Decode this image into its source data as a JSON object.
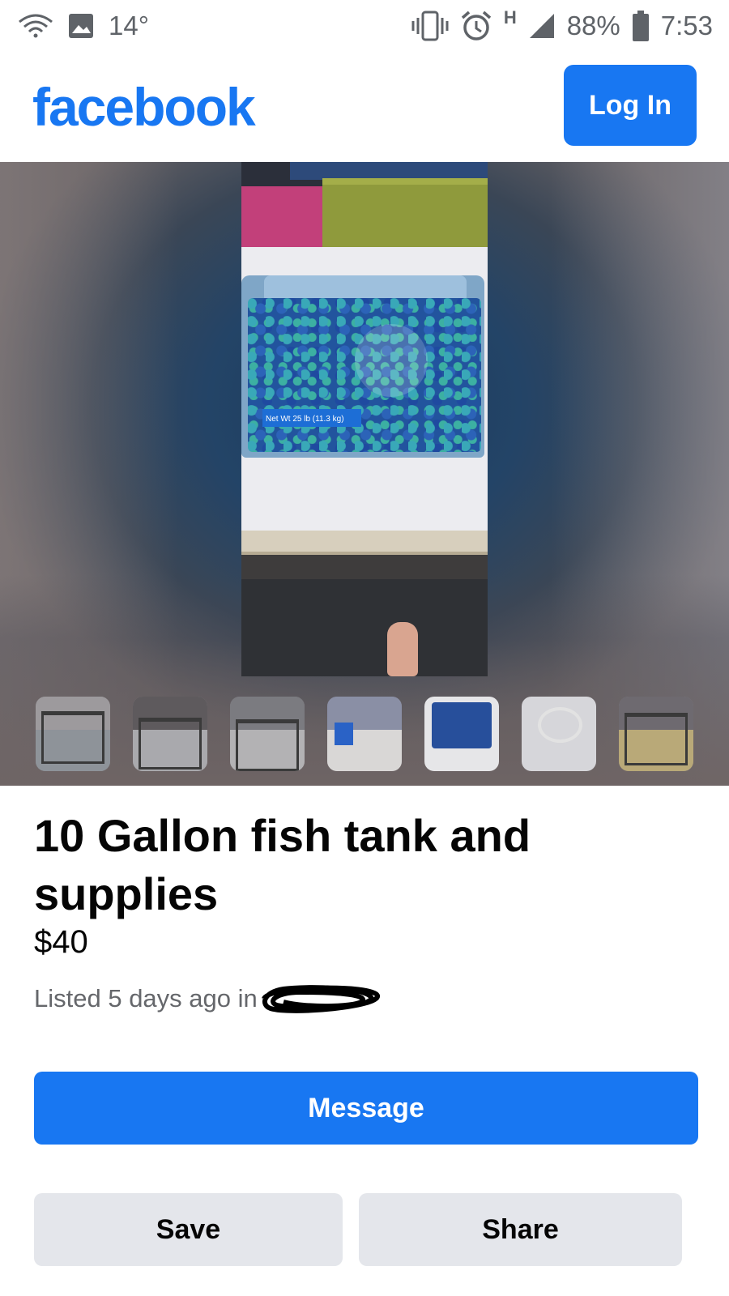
{
  "status_bar": {
    "temperature": "14°",
    "network_type": "H",
    "battery_percent": "88%",
    "time": "7:53",
    "icons": [
      "wifi-icon",
      "image-icon",
      "vibrate-icon",
      "alarm-icon",
      "signal-icon",
      "battery-icon"
    ]
  },
  "header": {
    "logo_text": "facebook",
    "login_label": "Log In",
    "brand_color": "#1877f2"
  },
  "gallery": {
    "photo_label": "Net Wt 25 lb (11.3 kg)",
    "selected_index": 4,
    "thumbnails": [
      "thumbnail-fish-tank",
      "thumbnail-tank-with-filter",
      "thumbnail-tank-with-cords",
      "thumbnail-supplies",
      "thumbnail-gravel-bag",
      "thumbnail-cable",
      "thumbnail-tank-decor"
    ]
  },
  "listing": {
    "title": "10 Gallon fish tank and supplies",
    "price": "$40",
    "listed_text": "Listed 5 days ago in"
  },
  "actions": {
    "message_label": "Message",
    "save_label": "Save",
    "share_label": "Share"
  },
  "colors": {
    "primary": "#1877f2",
    "secondary_button": "#e4e6eb",
    "meta_text": "#65676b"
  }
}
